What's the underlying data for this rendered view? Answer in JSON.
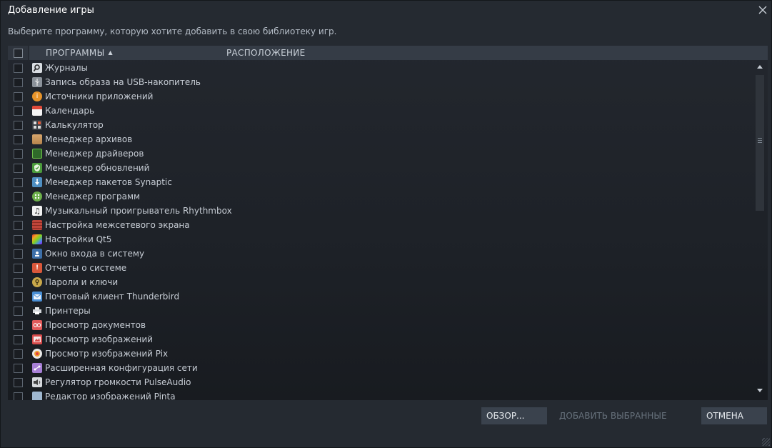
{
  "window": {
    "title": "Добавление игры",
    "subtitle": "Выберите программу, которую хотите добавить в свою библиотеку игр."
  },
  "table": {
    "columns": {
      "programs": "ПРОГРАММЫ",
      "location": "РАСПОЛОЖЕНИЕ"
    },
    "sort_indicator": "▲",
    "rows": [
      {
        "name": "Журналы",
        "icon": "magnifier-icon"
      },
      {
        "name": "Запись образа на USB-накопитель",
        "icon": "usb-icon"
      },
      {
        "name": "Источники приложений",
        "icon": "info-icon"
      },
      {
        "name": "Календарь",
        "icon": "calendar-icon"
      },
      {
        "name": "Калькулятор",
        "icon": "calculator-icon"
      },
      {
        "name": "Менеджер архивов",
        "icon": "archive-icon"
      },
      {
        "name": "Менеджер драйверов",
        "icon": "chip-icon"
      },
      {
        "name": "Менеджер обновлений",
        "icon": "shield-icon"
      },
      {
        "name": "Менеджер пакетов Synaptic",
        "icon": "package-download-icon"
      },
      {
        "name": "Менеджер программ",
        "icon": "software-grid-icon"
      },
      {
        "name": "Музыкальный проигрыватель Rhythmbox",
        "icon": "music-note-icon"
      },
      {
        "name": "Настройка межсетевого экрана",
        "icon": "firewall-icon"
      },
      {
        "name": "Настройки Qt5",
        "icon": "qt-settings-icon"
      },
      {
        "name": "Окно входа в систему",
        "icon": "login-window-icon"
      },
      {
        "name": "Отчеты о системе",
        "icon": "warning-report-icon"
      },
      {
        "name": "Пароли и ключи",
        "icon": "key-icon"
      },
      {
        "name": "Почтовый клиент Thunderbird",
        "icon": "mail-icon"
      },
      {
        "name": "Принтеры",
        "icon": "printer-icon"
      },
      {
        "name": "Просмотр документов",
        "icon": "document-viewer-icon"
      },
      {
        "name": "Просмотр изображений",
        "icon": "image-viewer-icon"
      },
      {
        "name": "Просмотр изображений Pix",
        "icon": "pix-icon"
      },
      {
        "name": "Расширенная конфигурация сети",
        "icon": "network-config-icon"
      },
      {
        "name": "Регулятор громкости PulseAudio",
        "icon": "volume-icon"
      },
      {
        "name": "Редактор изображений Pinta",
        "icon": "pinta-icon"
      }
    ]
  },
  "buttons": {
    "browse": "ОБЗОР...",
    "add_selected": "ДОБАВИТЬ ВЫБРАННЫЕ",
    "cancel": "ОТМЕНА"
  },
  "colors": {
    "window_bg": "#252a31",
    "header_bg": "#353c46",
    "button_bg": "#3a424d",
    "text": "#c6ccd4"
  }
}
